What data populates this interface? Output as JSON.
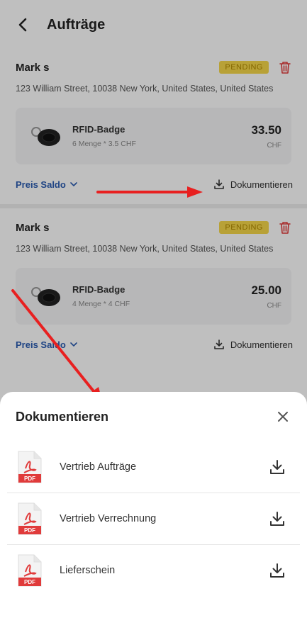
{
  "header": {
    "title": "Aufträge",
    "back_icon": "chevron-left-icon"
  },
  "orders": [
    {
      "customer": "Mark s",
      "status": "PENDING",
      "address": "123 William Street, 10038 New York, United States, United States",
      "item": {
        "name": "RFID-Badge",
        "detail": "6 Menge * 3.5 CHF",
        "price": "33.50",
        "currency": "CHF"
      },
      "saldo_label": "Preis Saldo",
      "documents_label": "Dokumentieren"
    },
    {
      "customer": "Mark s",
      "status": "PENDING",
      "address": "123 William Street, 10038 New York, United States, United States",
      "item": {
        "name": "RFID-Badge",
        "detail": "4 Menge * 4 CHF",
        "price": "25.00",
        "currency": "CHF"
      },
      "saldo_label": "Preis Saldo",
      "documents_label": "Dokumentieren"
    }
  ],
  "sheet": {
    "title": "Dokumentieren",
    "documents": [
      {
        "label": "Vertrieb Aufträge",
        "icon": "pdf-icon"
      },
      {
        "label": "Vertrieb Verrechnung",
        "icon": "pdf-icon"
      },
      {
        "label": "Lieferschein",
        "icon": "pdf-icon"
      }
    ]
  },
  "colors": {
    "badge_bg": "#f6d74a",
    "link": "#2a5bb0",
    "trash": "#e23b3b",
    "arrow": "#e82020",
    "pdf_red": "#e03b3b"
  }
}
